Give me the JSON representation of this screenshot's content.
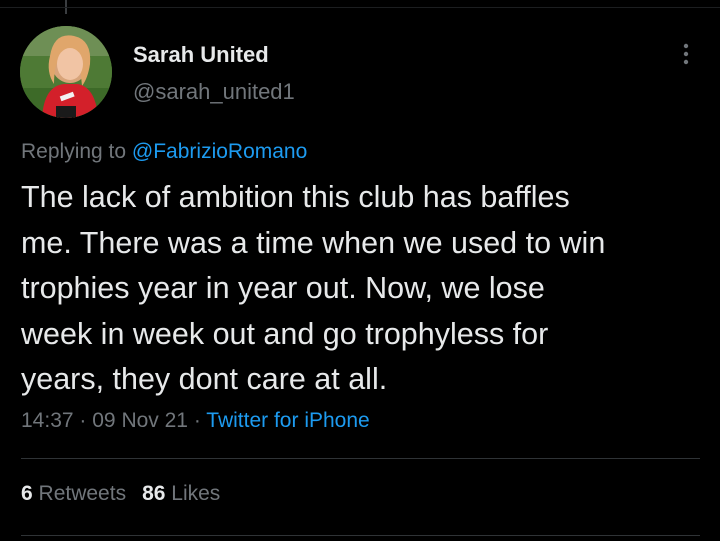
{
  "user": {
    "display_name": "Sarah United",
    "handle": "@sarah_united1"
  },
  "reply": {
    "prefix": "Replying to",
    "mention": "@FabrizioRomano"
  },
  "tweet": {
    "text": "The lack of ambition this club has baffles\nme. There was a time when we used to win\ntrophies year in year out. Now, we lose\nweek in week out and go trophyless for\nyears, they dont care at all."
  },
  "meta": {
    "time": "14:37",
    "separator": "·",
    "date": "09 Nov 21",
    "source": "Twitter for iPhone"
  },
  "stats": {
    "retweets_count": "6",
    "retweets_label": "Retweets",
    "likes_count": "86",
    "likes_label": "Likes"
  },
  "icons": {
    "more": "more-vertical-icon",
    "avatar": "profile-photo"
  },
  "colors": {
    "background": "#000000",
    "primary_text": "#e7e9ea",
    "secondary_text": "#71767b",
    "accent": "#1d9bf0",
    "divider": "#2f3336"
  }
}
